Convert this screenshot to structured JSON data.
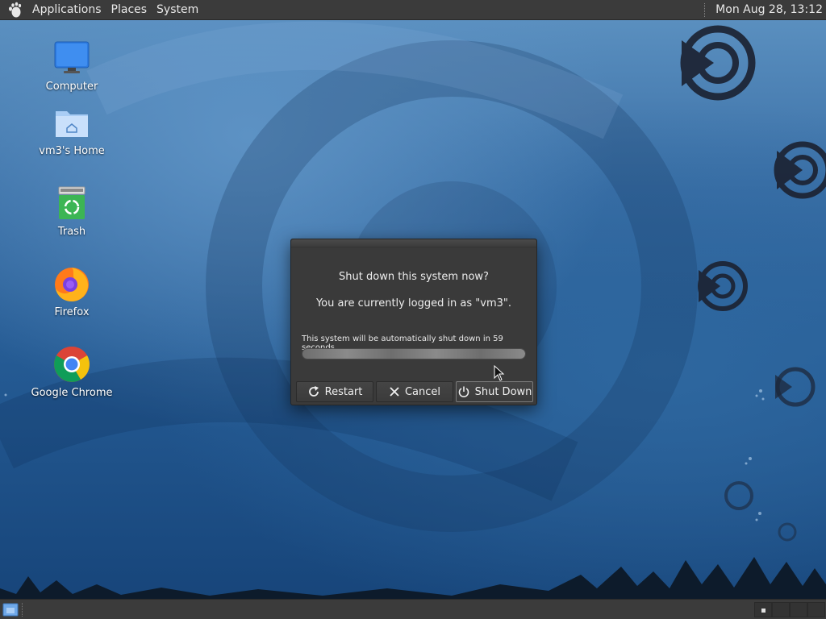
{
  "top_panel": {
    "menus": [
      "Applications",
      "Places",
      "System"
    ],
    "clock": "Mon Aug 28, 13:12"
  },
  "desktop": {
    "icons": [
      {
        "label": "Computer",
        "icon": "computer-icon"
      },
      {
        "label": "vm3's Home",
        "icon": "home-folder-icon"
      },
      {
        "label": "Trash",
        "icon": "trash-icon"
      },
      {
        "label": "Firefox",
        "icon": "firefox-icon"
      },
      {
        "label": "Google Chrome",
        "icon": "chrome-icon"
      }
    ]
  },
  "dialog": {
    "heading": "Shut down this system now?",
    "user_message": "You are currently logged in as \"vm3\".",
    "countdown": "This system will be automatically shut down in 59 seconds",
    "buttons": {
      "restart": "Restart",
      "cancel": "Cancel",
      "shutdown": "Shut Down"
    }
  },
  "bottom_panel": {
    "workspaces": 4,
    "active_workspace": 1
  },
  "colors": {
    "panel": "#3b3b3b",
    "dialog": "#3a3a3a",
    "wallpaper": "#245a93"
  }
}
